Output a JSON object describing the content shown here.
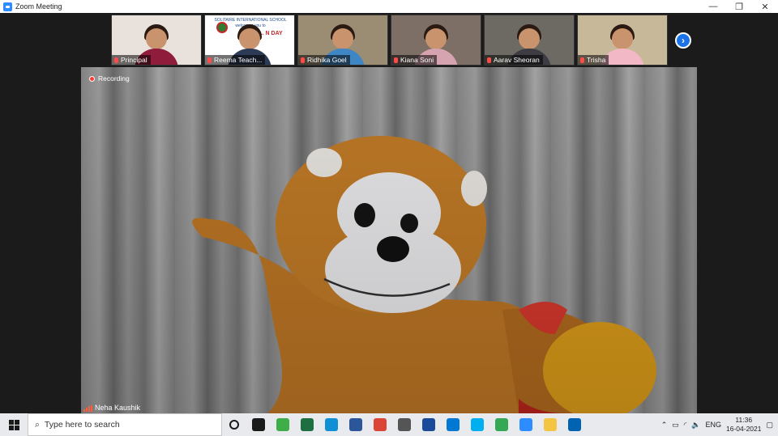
{
  "window": {
    "title": "Zoom Meeting",
    "controls": {
      "minimize": "—",
      "restore": "❐",
      "close": "✕"
    }
  },
  "participants": [
    {
      "name": "Principal",
      "bg": "#e9e2dc",
      "body": "#8e1c3a"
    },
    {
      "name": "Reema Teach...",
      "bg": "#ffffff",
      "body": "#2d3a55",
      "banner": {
        "school": "SOLITAIRE INTERNATIONAL SCHOOL",
        "welcome": "welcomes you to",
        "event": "FOU... N DAY"
      }
    },
    {
      "name": "Ridhika Goel",
      "bg": "#9b8c74",
      "body": "#3e86c4"
    },
    {
      "name": "Kiana Soni",
      "bg": "#7d6f66",
      "body": "#d6a3b0"
    },
    {
      "name": "Aarav Sheoran",
      "bg": "#6c6a62",
      "body": "#3c3c42"
    },
    {
      "name": "Trisha",
      "bg": "#c8b89a",
      "body": "#f2b8c6"
    }
  ],
  "next_page_icon": "chevron-right-icon",
  "main_video": {
    "recording_label": "Recording",
    "speaker_name": "Neha Kaushik"
  },
  "taskbar": {
    "search_placeholder": "Type here to search",
    "apps": [
      {
        "icon": "cortana-icon",
        "color": "#1a1a1a"
      },
      {
        "icon": "task-view-icon",
        "color": "#1a1a1a"
      },
      {
        "icon": "n-app-icon",
        "color": "#3fae49"
      },
      {
        "icon": "excel-icon",
        "color": "#1d6f42"
      },
      {
        "icon": "edge-icon",
        "color": "#0f8fd4"
      },
      {
        "icon": "word-icon",
        "color": "#2b579a"
      },
      {
        "icon": "chrome-icon",
        "color": "#db4437"
      },
      {
        "icon": "store-icon",
        "color": "#555555"
      },
      {
        "icon": "photos-icon",
        "color": "#1a4a9a"
      },
      {
        "icon": "mail-icon",
        "color": "#0078d4"
      },
      {
        "icon": "skype-icon",
        "color": "#00aff0"
      },
      {
        "icon": "chrome-icon",
        "color": "#34a853"
      },
      {
        "icon": "zoom-icon",
        "color": "#2d8cff"
      },
      {
        "icon": "file-explorer-icon",
        "color": "#f4c542"
      },
      {
        "icon": "media-player-icon",
        "color": "#0063b1"
      }
    ],
    "tray": {
      "language": "ENG",
      "time": "11:36",
      "date": "16-04-2021"
    }
  }
}
